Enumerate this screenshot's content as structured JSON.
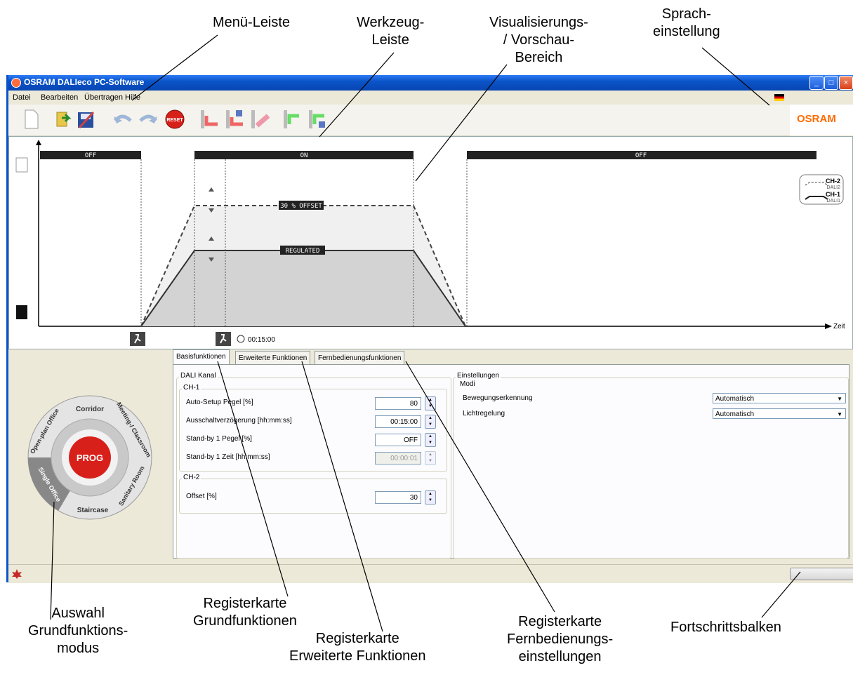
{
  "annotations": {
    "menu_bar": "Menü-Leiste",
    "toolbar_line1": "Werkzeug-",
    "toolbar_line2": "Leiste",
    "viz_line1": "Visualisierungs-",
    "viz_line2": "/ Vorschau-",
    "viz_line3": "Bereich",
    "lang_line1": "Sprach-",
    "lang_line2": "einstellung",
    "mode_line1": "Auswahl",
    "mode_line2": "Grundfunktions-",
    "mode_line3": "modus",
    "tab_basic_line1": "Registerkarte",
    "tab_basic_line2": "Grundfunktionen",
    "tab_ext_line1": "Registerkarte",
    "tab_ext_line2": "Erweiterte Funktionen",
    "tab_remote_line1": "Registerkarte",
    "tab_remote_line2": "Fernbedienungs-",
    "tab_remote_line3": "einstellungen",
    "progress": "Fortschrittsbalken"
  },
  "window": {
    "title": "OSRAM DALIeco PC-Software",
    "menu": [
      "Datei",
      "Bearbeiten",
      "Übertragen",
      "Hilfe"
    ],
    "brand": "OSRAM",
    "reset_label": "RESET"
  },
  "visualization": {
    "states": [
      "OFF",
      "ON",
      "OFF"
    ],
    "offset_label": "30 % OFFSET",
    "regulated_label": "REGULATED",
    "time_label": "00:15:00",
    "x_axis_label": "Zeit",
    "legend": [
      {
        "name": "CH-2",
        "sub": "DALI2"
      },
      {
        "name": "CH-1",
        "sub": "DALI1"
      }
    ]
  },
  "dial": {
    "center": "PROG",
    "segments": [
      "Corridor",
      "Meeting-/ Classroom",
      "Sanitary Room",
      "Staircase",
      "Single Office",
      "Open-plan Office"
    ]
  },
  "tabs": [
    "Basisfunktionen",
    "Erweiterte Funktionen",
    "Fernbedienungsfunktionen"
  ],
  "dali": {
    "group": "DALI Kanal",
    "ch1": {
      "label": "CH-1",
      "fields": [
        {
          "label": "Auto-Setup Pegel [%]",
          "value": "80"
        },
        {
          "label": "Ausschaltverzögerung [hh:mm:ss]",
          "value": "00:15:00"
        },
        {
          "label": "Stand-by 1 Pegel [%]",
          "value": "OFF"
        },
        {
          "label": "Stand-by 1 Zeit [hh:mm:ss]",
          "value": "00:00:01"
        }
      ]
    },
    "ch2": {
      "label": "CH-2",
      "fields": [
        {
          "label": "Offset [%]",
          "value": "30"
        }
      ]
    }
  },
  "settings": {
    "group": "Einstellungen",
    "sub": "Modi",
    "rows": [
      {
        "label": "Bewegungserkennung",
        "value": "Automatisch"
      },
      {
        "label": "Lichtregelung",
        "value": "Automatisch"
      }
    ]
  },
  "colors": {
    "accent": "#ff6a00",
    "titlebar": "#0a54c8",
    "prog": "#d8201b"
  }
}
